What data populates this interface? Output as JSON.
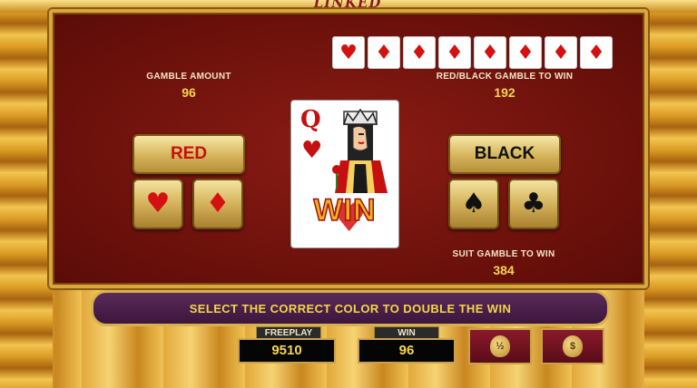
{
  "header": {
    "logo_text": "LINKED"
  },
  "gamble_amount": {
    "label": "GAMBLE AMOUNT",
    "value": "96"
  },
  "red_black_gamble": {
    "label": "RED/BLACK GAMBLE TO WIN",
    "value": "192"
  },
  "suit_gamble": {
    "label": "SUIT GAMBLE TO WIN",
    "value": "384"
  },
  "buttons": {
    "red": "RED",
    "black": "BLACK"
  },
  "suits": {
    "hearts": "♥",
    "diamonds": "♦",
    "spades": "♠",
    "clubs": "♣"
  },
  "history": [
    "♥",
    "♦",
    "♦",
    "♦",
    "♦",
    "♦",
    "♦",
    "♦"
  ],
  "card": {
    "rank": "Q",
    "suit": "♥",
    "result": "WIN"
  },
  "message": "SELECT THE CORRECT COLOR TO DOUBLE THE WIN",
  "meters": {
    "freeplay_label": "FREEPLAY",
    "freeplay_value": "9510",
    "win_label": "WIN",
    "win_value": "96"
  },
  "icon_buttons": {
    "half_collect": "½",
    "collect": "$"
  },
  "colors": {
    "red": "#d41010",
    "gold": "#f5d64a",
    "panel": "#7a140e"
  }
}
